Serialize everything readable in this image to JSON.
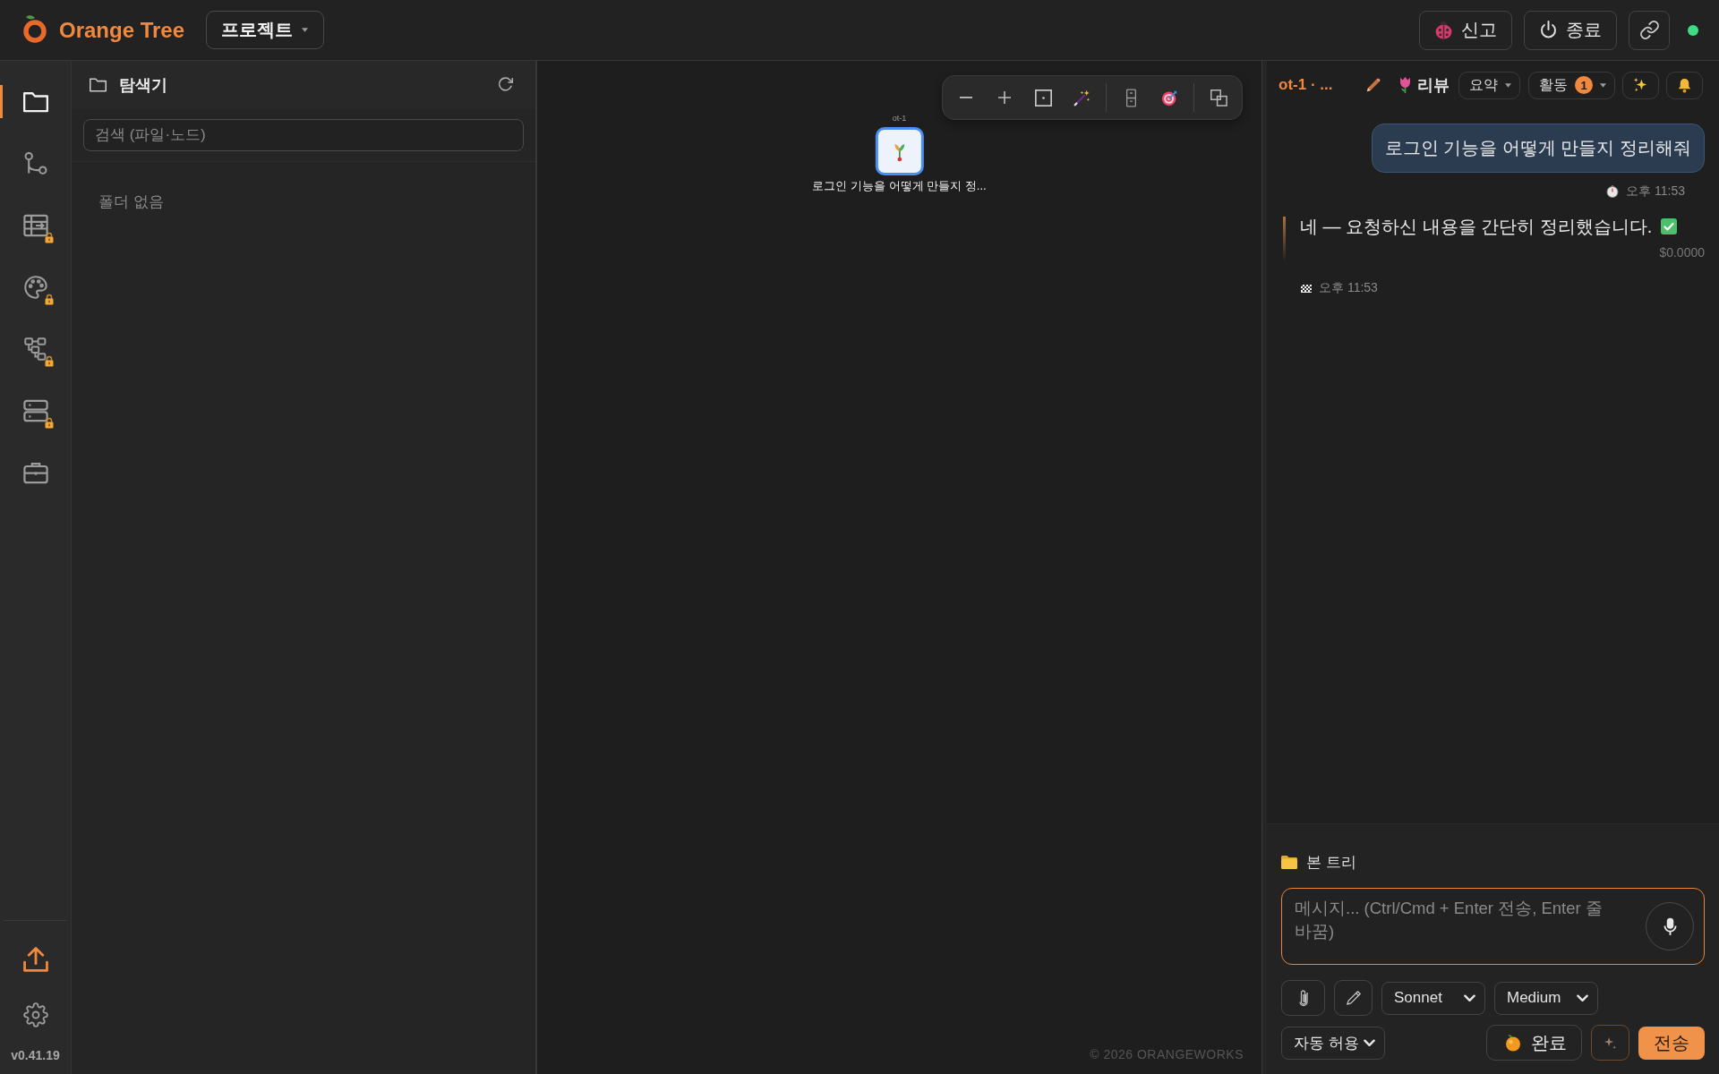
{
  "app": {
    "title": "Orange Tree",
    "project_menu": {
      "label": "프로젝트"
    }
  },
  "top_actions": [
    {
      "kind": "report",
      "label": "신고"
    },
    {
      "kind": "quit",
      "label": "종료"
    },
    {
      "kind": "link"
    }
  ],
  "connection": {
    "online": true
  },
  "activity_bar": {
    "items": [
      {
        "kind": "folder",
        "selected": true,
        "locked": false
      },
      {
        "kind": "branch",
        "selected": false,
        "locked": false
      },
      {
        "kind": "table",
        "selected": false,
        "locked": true
      },
      {
        "kind": "palette",
        "selected": false,
        "locked": true
      },
      {
        "kind": "hierarchy",
        "selected": false,
        "locked": true
      },
      {
        "kind": "server",
        "selected": false,
        "locked": true
      },
      {
        "kind": "briefcase",
        "selected": false,
        "locked": false
      }
    ],
    "footer": [
      {
        "kind": "upload"
      },
      {
        "kind": "settings"
      }
    ],
    "version": "v0.41.19"
  },
  "explorer": {
    "title": "탐색기",
    "search": {
      "placeholder": "검색 (파일·노드)"
    },
    "empty_text": "폴더 없음"
  },
  "canvas": {
    "toolbar": [
      {
        "kind": "zoom_out"
      },
      {
        "kind": "zoom_in"
      },
      {
        "kind": "fit"
      },
      {
        "kind": "wand"
      },
      {
        "kind": "divider"
      },
      {
        "kind": "cabinet"
      },
      {
        "kind": "target"
      },
      {
        "kind": "divider"
      },
      {
        "kind": "windows"
      }
    ],
    "nodes": [
      {
        "tag": "ot-1",
        "label": "로그인 기능을 어떻게 만들지 정...",
        "selected": true
      }
    ],
    "footer": "© 2026 ORANGEWORKS"
  },
  "chat": {
    "header": {
      "title": "ot-1 · ...",
      "stage": "리뷰",
      "menus": [
        {
          "label": "요약"
        },
        {
          "label": "활동",
          "badge": "1"
        }
      ],
      "actions": [
        {
          "kind": "sparkles"
        },
        {
          "kind": "bell"
        }
      ]
    },
    "messages": [
      {
        "kind": "user",
        "text": "로그인 기능을 어떻게 만들지 정리해줘",
        "time": "오후 11:53"
      },
      {
        "kind": "assistant",
        "text": "네 — 요청하신 내용을 간단히 정리했습니다.",
        "done": true,
        "cost": "$0.0000",
        "time": "오후 11:53"
      }
    ],
    "context": {
      "label": "본 트리"
    },
    "composer": {
      "placeholder": "메시지... (Ctrl/Cmd + Enter 전송, Enter 줄 바꿈)",
      "tools": [
        {
          "kind": "attach"
        },
        {
          "kind": "draw"
        }
      ],
      "model": "Sonnet",
      "effort": "Medium",
      "permission": "자동 허용",
      "done_button": "완료",
      "send_button": "전송"
    }
  }
}
